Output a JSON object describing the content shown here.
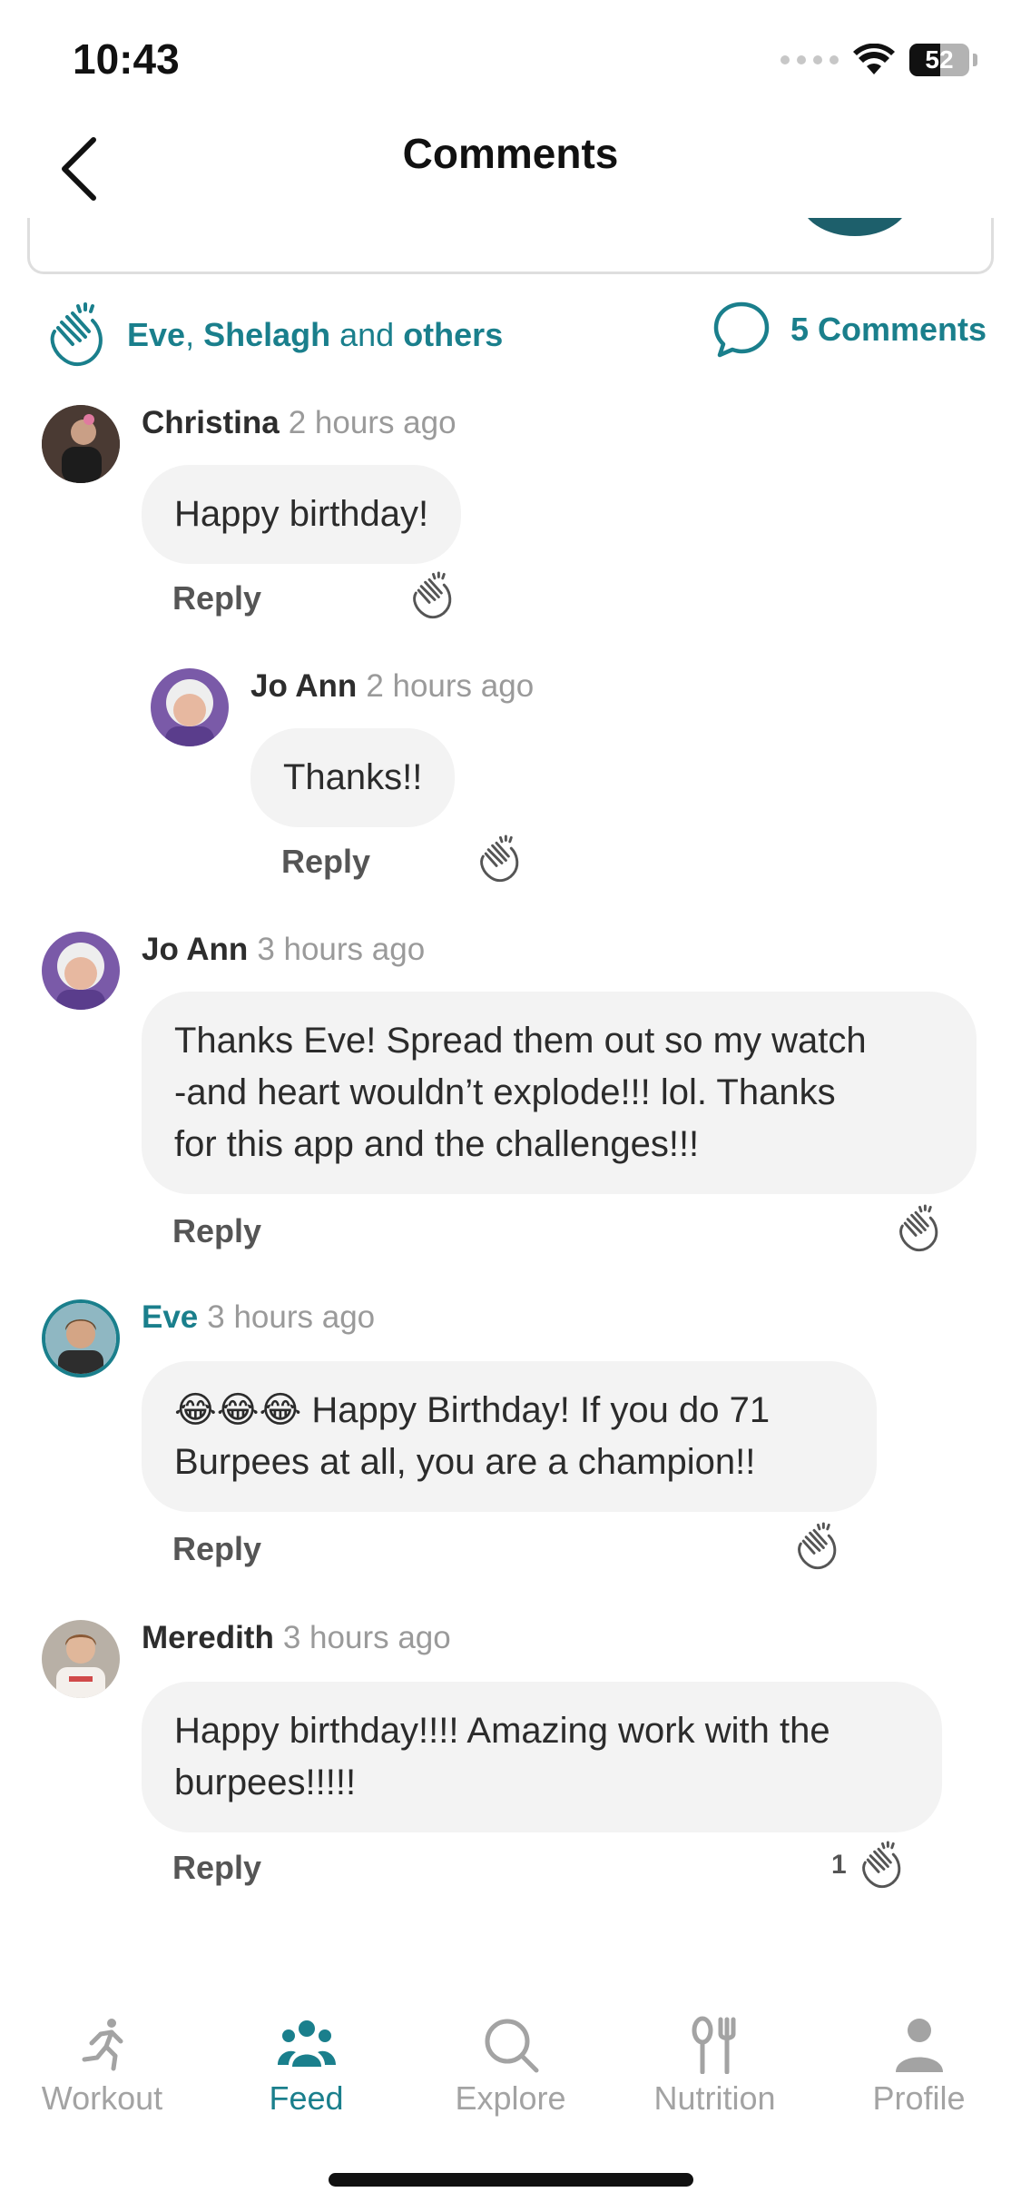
{
  "status_bar": {
    "time": "10:43",
    "battery": "52",
    "battery_level": 0.52
  },
  "header": {
    "title": "Comments"
  },
  "reactions": {
    "name1": "Eve",
    "sep": ", ",
    "name2": "Shelagh",
    "and": " and ",
    "others": "others",
    "comments_count": "5 Comments"
  },
  "comments": [
    {
      "author": "Christina",
      "time": "2 hours ago",
      "text": "Happy birthday!",
      "reply_label": "Reply",
      "clap_count": ""
    },
    {
      "author": "Jo Ann",
      "time": "2 hours ago",
      "text": "Thanks!!",
      "reply_label": "Reply",
      "clap_count": ""
    },
    {
      "author": "Jo Ann",
      "time": "3 hours ago",
      "line1": "Thanks Eve!  Spread them out so my watch",
      "line2": "-and heart wouldn’t explode!!! lol. Thanks",
      "line3": "for this app and the challenges!!!",
      "reply_label": "Reply",
      "clap_count": ""
    },
    {
      "author": "Eve",
      "time": "3 hours ago",
      "line1": "😂😂😂 Happy Birthday! If you do 71",
      "line2": "Burpees at all, you are a champion!!",
      "reply_label": "Reply",
      "clap_count": ""
    },
    {
      "author": "Meredith",
      "time": "3 hours ago",
      "line1": "Happy birthday!!!! Amazing work with the",
      "line2": "burpees!!!!!",
      "reply_label": "Reply",
      "clap_count": "1"
    }
  ],
  "tabs": [
    {
      "label": "Workout",
      "icon": "runner-icon"
    },
    {
      "label": "Feed",
      "icon": "people-icon"
    },
    {
      "label": "Explore",
      "icon": "search-icon"
    },
    {
      "label": "Nutrition",
      "icon": "fork-knife-icon"
    },
    {
      "label": "Profile",
      "icon": "person-icon"
    }
  ],
  "colors": {
    "accent": "#1a7f8c",
    "bubble": "#f3f3f3",
    "muted": "#9a9a9a"
  }
}
